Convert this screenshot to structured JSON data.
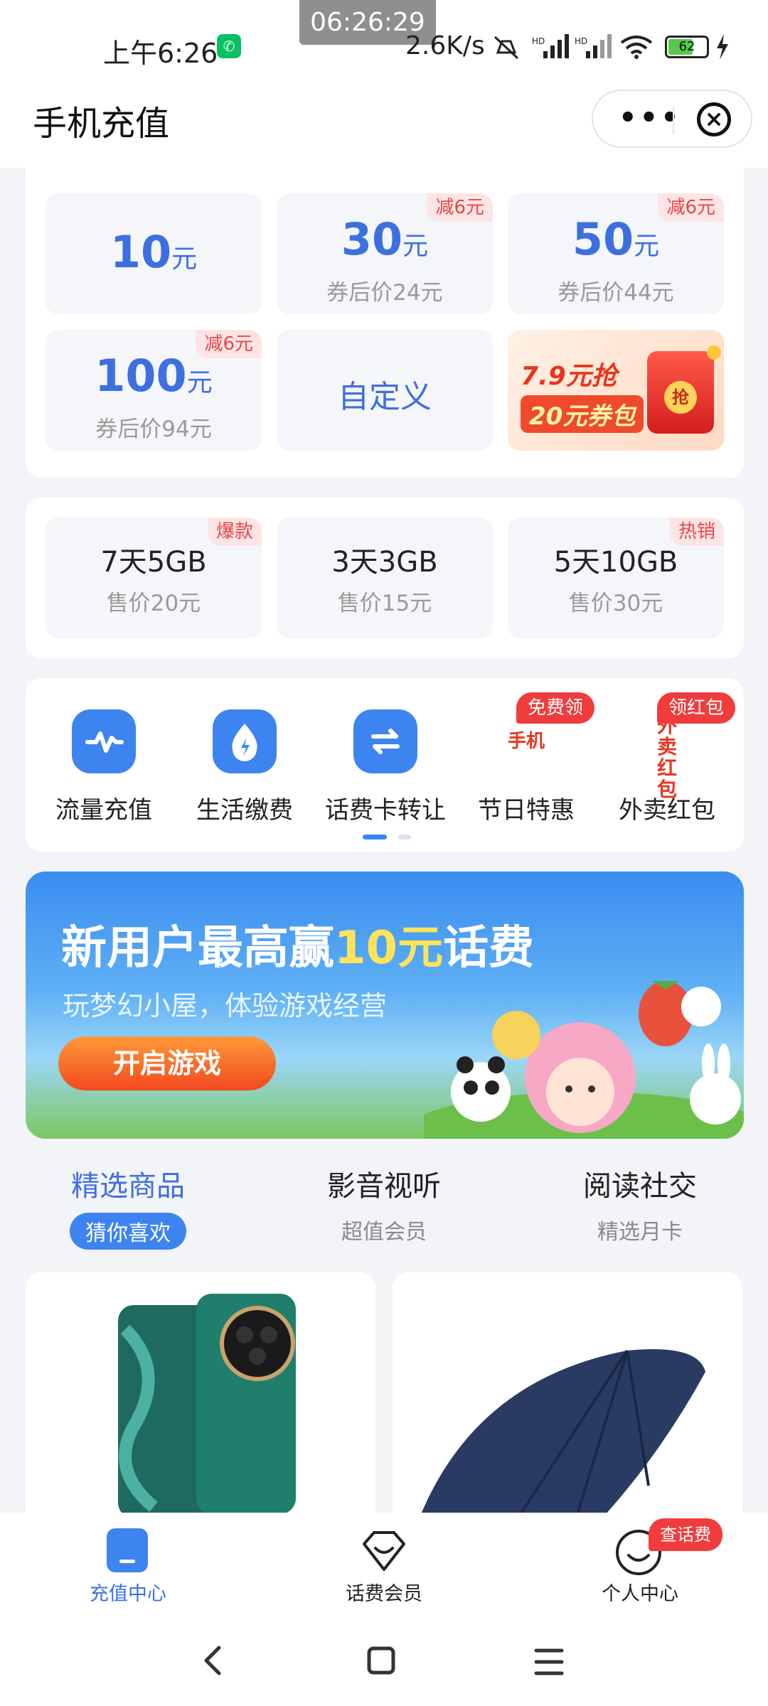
{
  "status_bar": {
    "time": "上午6:26",
    "clock_overlay": "06:26:29",
    "net_speed": "2.6K/s",
    "battery": "62"
  },
  "titlebar": {
    "title": "手机充值",
    "more_label": "•••"
  },
  "recharge": {
    "tiles": [
      {
        "amount": "10",
        "unit": "元",
        "after": "",
        "tag": ""
      },
      {
        "amount": "30",
        "unit": "元",
        "after": "券后价24元",
        "tag": "减6元"
      },
      {
        "amount": "50",
        "unit": "元",
        "after": "券后价44元",
        "tag": "减6元"
      },
      {
        "amount": "100",
        "unit": "元",
        "after": "券后价94元",
        "tag": "减6元"
      }
    ],
    "custom_label": "自定义",
    "promo": {
      "line1": "7.9元抢",
      "line2": "20元券包",
      "badge": "抢"
    }
  },
  "data_plans": [
    {
      "name": "7天5GB",
      "price": "售价20元",
      "tag": "爆款"
    },
    {
      "name": "3天3GB",
      "price": "售价15元",
      "tag": ""
    },
    {
      "name": "5天10GB",
      "price": "售价30元",
      "tag": "热销"
    }
  ],
  "services": [
    {
      "label": "流量充值",
      "icon": "pulse-icon"
    },
    {
      "label": "生活缴费",
      "icon": "drop-bolt-icon"
    },
    {
      "label": "话费卡转让",
      "icon": "swap-icon"
    },
    {
      "label": "节日特惠",
      "icon": "phone-logo-icon",
      "logo_text": "手机",
      "badge": "免费领"
    },
    {
      "label": "外卖红包",
      "icon": "takeout-logo-icon",
      "logo_text": "外卖红包",
      "badge": "领红包"
    }
  ],
  "banner": {
    "title_prefix": "新用户最高赢",
    "title_highlight": "10元",
    "title_suffix": "话费",
    "subtitle": "玩梦幻小屋，体验游戏经营",
    "button": "开启游戏"
  },
  "categories": [
    {
      "title": "精选商品",
      "sub": "猜你喜欢",
      "active": true
    },
    {
      "title": "影音视听",
      "sub": "超值会员",
      "active": false
    },
    {
      "title": "阅读社交",
      "sub": "精选月卡",
      "active": false
    }
  ],
  "bottom_nav": [
    {
      "label": "充值中心",
      "icon": "phone-icon",
      "active": true
    },
    {
      "label": "话费会员",
      "icon": "diamond-icon",
      "active": false
    },
    {
      "label": "个人中心",
      "icon": "smile-icon",
      "active": false,
      "badge": "查话费"
    }
  ],
  "colors": {
    "accent": "#3e6fe0",
    "tag_red": "#e94545",
    "badge_red": "#f03c3c"
  }
}
